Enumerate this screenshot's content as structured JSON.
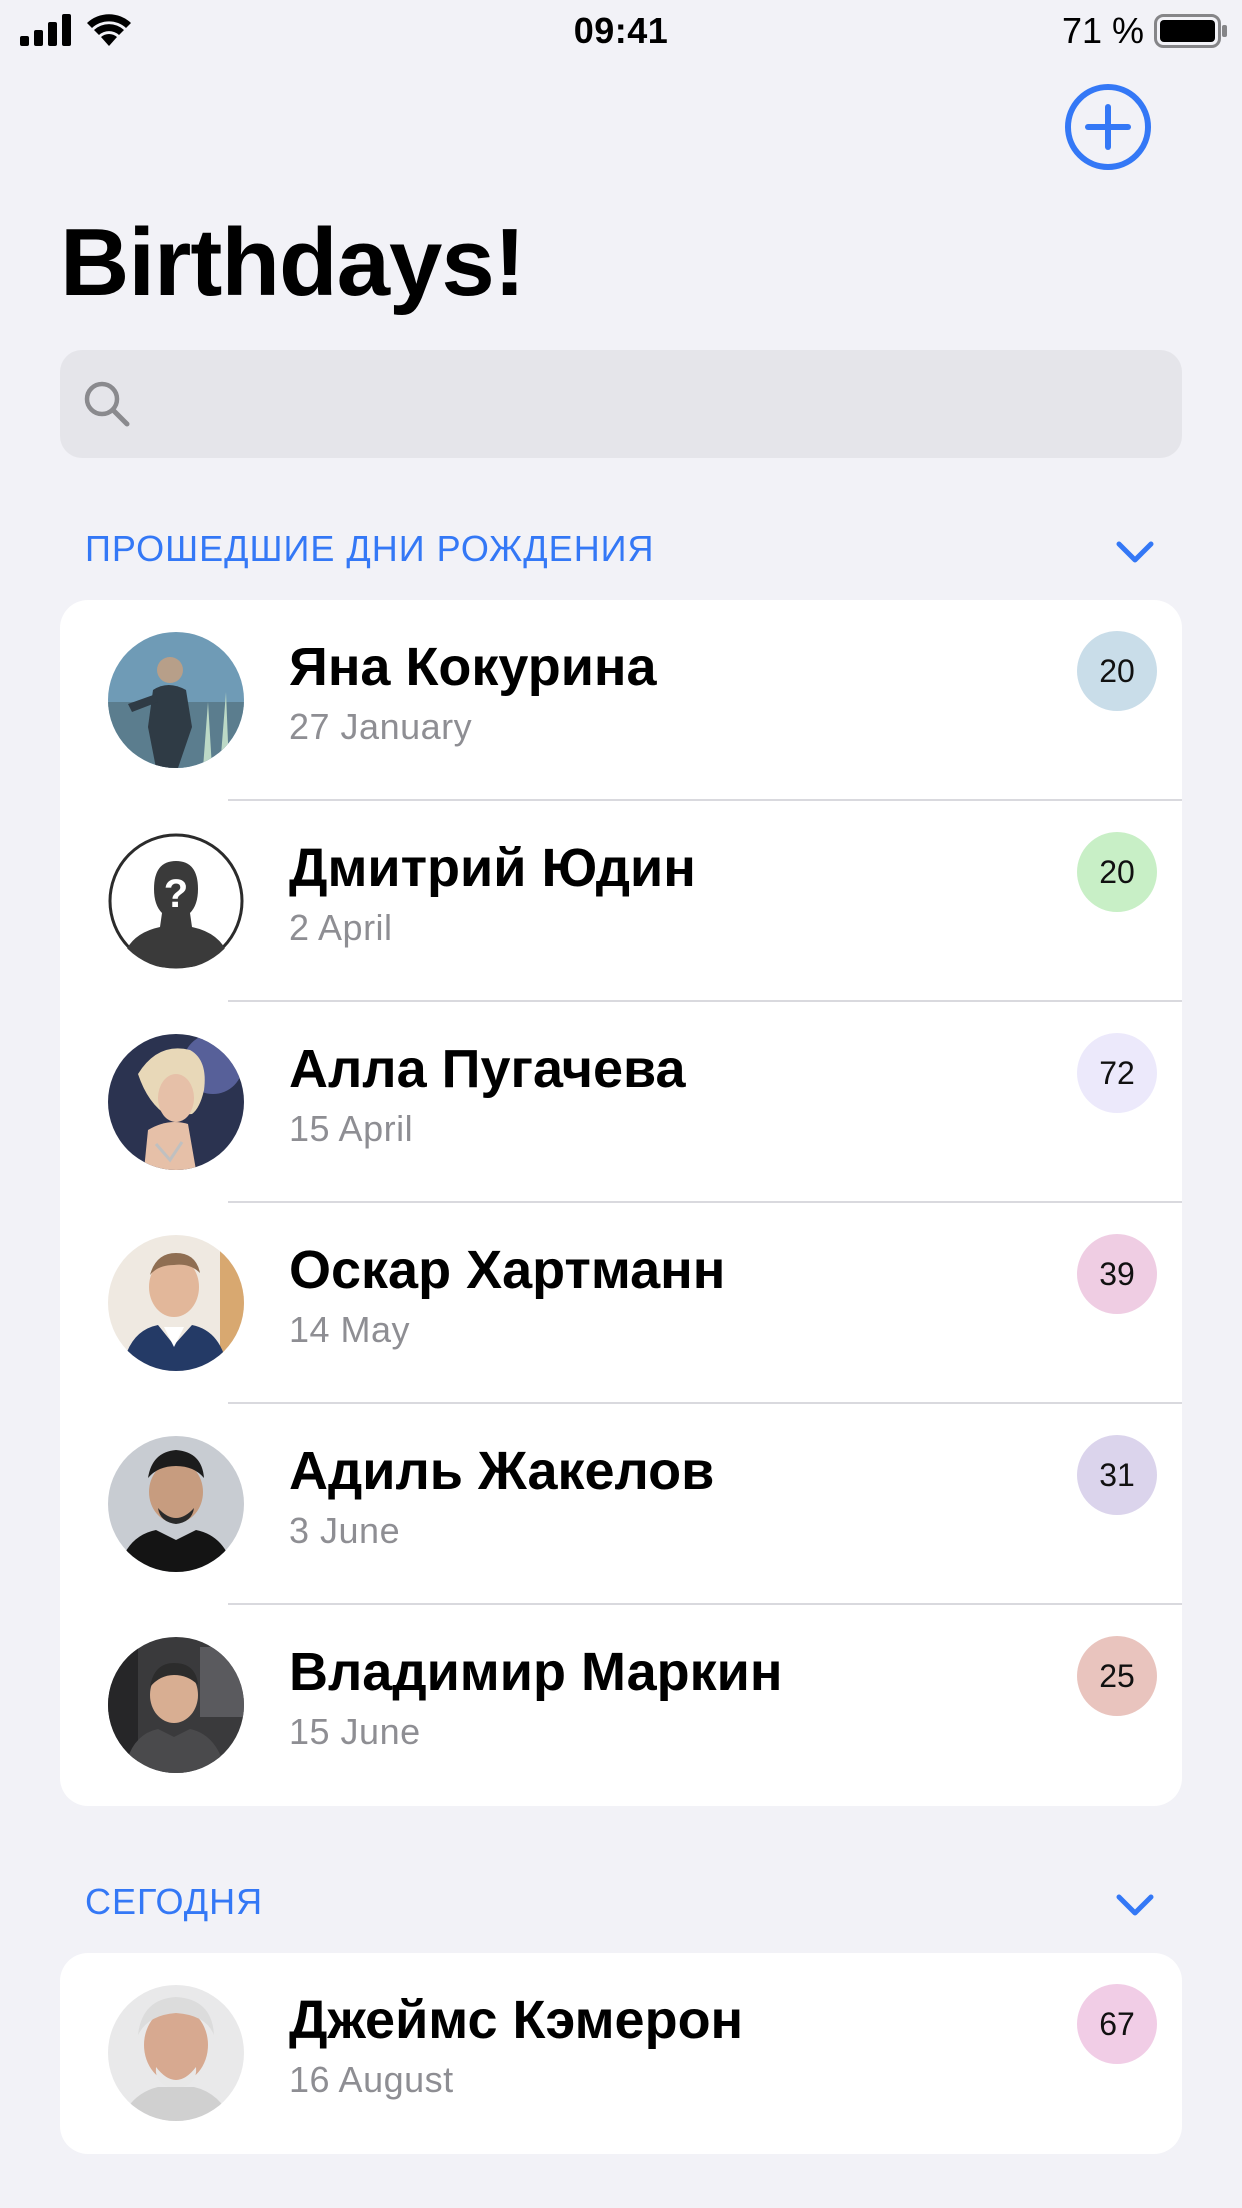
{
  "status_bar": {
    "time": "09:41",
    "battery_percent": "71 %"
  },
  "header": {
    "title": "Birthdays!",
    "add_icon": "plus-circle-icon"
  },
  "search": {
    "placeholder": "",
    "value": "",
    "icon": "search-icon"
  },
  "sections": [
    {
      "title": "ПРОШЕДШИЕ ДНИ РОЖДЕНИЯ",
      "items": [
        {
          "name": "Яна Кокурина",
          "date": "27 January",
          "age": "20",
          "badge_color": "#c9dde9"
        },
        {
          "name": "Дмитрий Юдин",
          "date": "2 April",
          "age": "20",
          "badge_color": "#c8efc6"
        },
        {
          "name": "Алла Пугачева",
          "date": "15 April",
          "age": "72",
          "badge_color": "#ece9fb"
        },
        {
          "name": "Оскар Хартманн",
          "date": "14 May",
          "age": "39",
          "badge_color": "#efcde3"
        },
        {
          "name": "Адиль Жакелов",
          "date": "3 June",
          "age": "31",
          "badge_color": "#dbd4ec"
        },
        {
          "name": "Владимир Маркин",
          "date": "15 June",
          "age": "25",
          "badge_color": "#e9c4be"
        }
      ]
    },
    {
      "title": "СЕГОДНЯ",
      "items": [
        {
          "name": "Джеймс Кэмерон",
          "date": "16 August",
          "age": "67",
          "badge_color": "#f1cde6"
        }
      ]
    }
  ],
  "colors": {
    "accent": "#3478f6",
    "background": "#f2f2f7"
  }
}
